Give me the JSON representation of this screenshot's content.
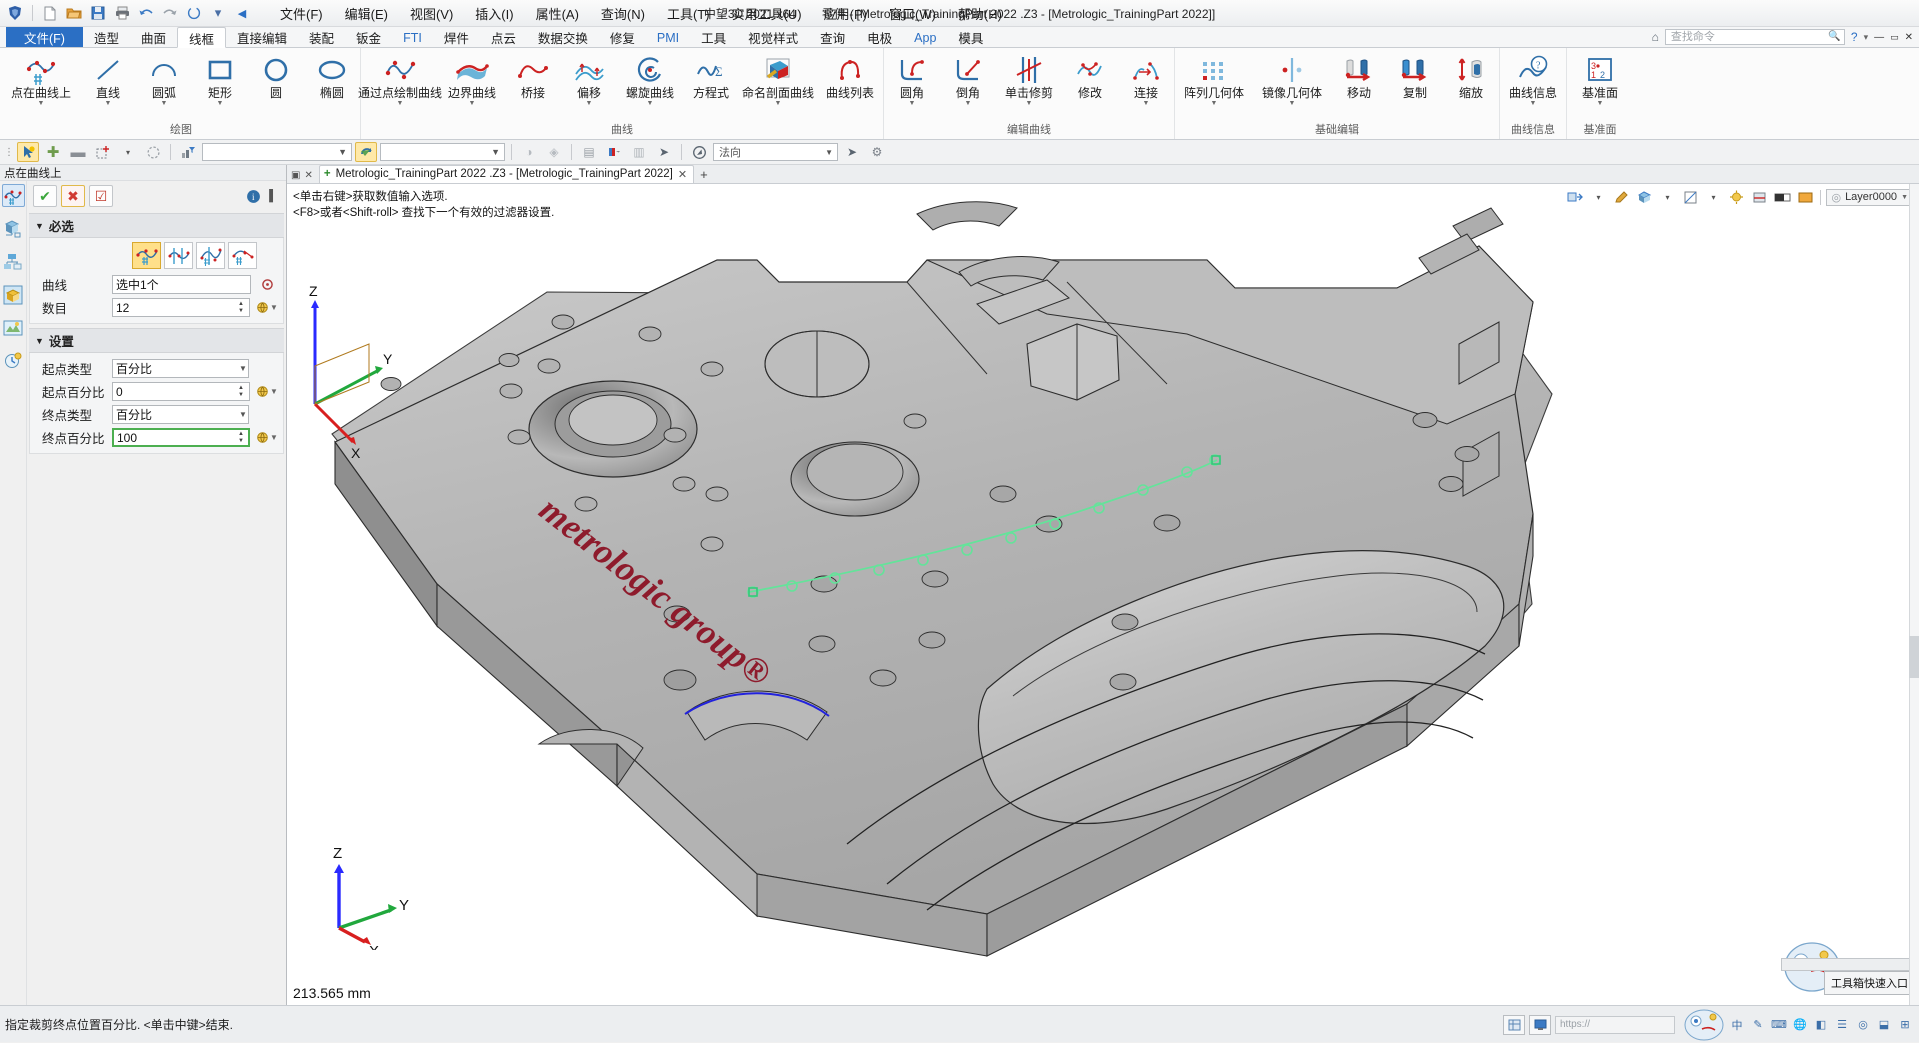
{
  "titlebar": {
    "quick_access": [
      "new-icon",
      "open-icon",
      "save-icon",
      "print-icon",
      "undo-icon",
      "redo-icon",
      "refresh-icon",
      "dropdown-icon",
      "back-icon"
    ],
    "menus": [
      "文件(F)",
      "编辑(E)",
      "视图(V)",
      "插入(I)",
      "属性(A)",
      "查询(N)",
      "工具(T)",
      "实用工具(U)",
      "应用(P)",
      "窗口(W)",
      "帮助(H)"
    ],
    "app_name": "中望3D 2021 x64",
    "document_title": "零件 - [Metrologic_TrainingPart  2022 .Z3 - [Metrologic_TrainingPart  2022]]",
    "window_buttons": [
      "−",
      "▭",
      "✕"
    ]
  },
  "ribbon": {
    "tabs": [
      {
        "label": "文件(F)",
        "style": "file"
      },
      {
        "label": "造型",
        "style": ""
      },
      {
        "label": "曲面",
        "style": ""
      },
      {
        "label": "线框",
        "style": "active"
      },
      {
        "label": "直接编辑",
        "style": ""
      },
      {
        "label": "装配",
        "style": ""
      },
      {
        "label": "钣金",
        "style": ""
      },
      {
        "label": "FTI",
        "style": "blue"
      },
      {
        "label": "焊件",
        "style": ""
      },
      {
        "label": "点云",
        "style": ""
      },
      {
        "label": "数据交换",
        "style": ""
      },
      {
        "label": "修复",
        "style": ""
      },
      {
        "label": "PMI",
        "style": "blue"
      },
      {
        "label": "工具",
        "style": ""
      },
      {
        "label": "视觉样式",
        "style": ""
      },
      {
        "label": "查询",
        "style": ""
      },
      {
        "label": "电极",
        "style": ""
      },
      {
        "label": "App",
        "style": "blue"
      },
      {
        "label": "模具",
        "style": ""
      }
    ],
    "search_placeholder": "查找命令",
    "home_icon": "home-icon",
    "help_icon": "help-icon",
    "groups": [
      {
        "name": "绘图",
        "items": [
          {
            "label": "点在曲线上",
            "icon": "point-on-curve-icon",
            "dropdown": true,
            "width": "xwide"
          },
          {
            "label": "直线",
            "icon": "line-icon",
            "dropdown": true,
            "width": ""
          },
          {
            "label": "圆弧",
            "icon": "arc-icon",
            "dropdown": true,
            "width": ""
          },
          {
            "label": "矩形",
            "icon": "rectangle-icon",
            "dropdown": true,
            "width": ""
          },
          {
            "label": "圆",
            "icon": "circle-icon",
            "dropdown": false,
            "width": ""
          },
          {
            "label": "椭圆",
            "icon": "ellipse-icon",
            "dropdown": false,
            "width": ""
          }
        ]
      },
      {
        "name": "曲线",
        "items": [
          {
            "label": "通过点绘制曲线",
            "icon": "curve-through-points-icon",
            "dropdown": true,
            "width": "xwide"
          },
          {
            "label": "边界曲线",
            "icon": "boundary-curve-icon",
            "dropdown": true,
            "width": "wide"
          },
          {
            "label": "桥接",
            "icon": "bridge-icon",
            "dropdown": false,
            "width": ""
          },
          {
            "label": "偏移",
            "icon": "offset-icon",
            "dropdown": true,
            "width": ""
          },
          {
            "label": "螺旋曲线",
            "icon": "helix-icon",
            "dropdown": true,
            "width": "wide"
          },
          {
            "label": "方程式",
            "icon": "equation-icon",
            "dropdown": false,
            "width": ""
          },
          {
            "label": "命名剖面曲线",
            "icon": "named-section-curve-icon",
            "dropdown": true,
            "width": "xwide"
          },
          {
            "label": "曲线列表",
            "icon": "curve-list-icon",
            "dropdown": false,
            "width": "wide"
          }
        ]
      },
      {
        "name": "编辑曲线",
        "items": [
          {
            "label": "圆角",
            "icon": "fillet-icon",
            "dropdown": true,
            "width": ""
          },
          {
            "label": "倒角",
            "icon": "chamfer-icon",
            "dropdown": true,
            "width": ""
          },
          {
            "label": "单击修剪",
            "icon": "click-trim-icon",
            "dropdown": true,
            "width": "wide"
          },
          {
            "label": "修改",
            "icon": "modify-icon",
            "dropdown": false,
            "width": ""
          },
          {
            "label": "连接",
            "icon": "connect-icon",
            "dropdown": true,
            "width": ""
          }
        ]
      },
      {
        "name": "基础编辑",
        "items": [
          {
            "label": "阵列几何体",
            "icon": "pattern-geometry-icon",
            "dropdown": true,
            "width": "xwide"
          },
          {
            "label": "镜像几何体",
            "icon": "mirror-geometry-icon",
            "dropdown": true,
            "width": "xwide"
          },
          {
            "label": "移动",
            "icon": "move-icon",
            "dropdown": false,
            "width": ""
          },
          {
            "label": "复制",
            "icon": "copy-icon",
            "dropdown": false,
            "width": ""
          },
          {
            "label": "缩放",
            "icon": "scale-icon",
            "dropdown": false,
            "width": ""
          }
        ]
      },
      {
        "name": "曲线信息",
        "items": [
          {
            "label": "曲线信息",
            "icon": "curve-info-icon",
            "dropdown": true,
            "width": "wide"
          }
        ]
      },
      {
        "name": "基准面",
        "items": [
          {
            "label": "基准面",
            "icon": "datum-plane-icon",
            "dropdown": true,
            "width": "wide"
          }
        ]
      }
    ]
  },
  "attrbar": {
    "icons": [
      "pointer-select-icon",
      "add-icon",
      "remove-icon",
      "add-point-icon",
      "dropdown-icon",
      "circle-select-icon",
      "filter-icon"
    ],
    "combo_value": "",
    "sync_icon": "sync-icon",
    "right_icons": [
      "render-icon",
      "shade-icon",
      "face-icon",
      "face-color-icon",
      "layer-icon",
      "pointer-icon"
    ],
    "normal_label": "法向",
    "tail_icons": [
      "arrow-icon",
      "settings-gear-icon"
    ]
  },
  "left_panel": {
    "title": "点在曲线上",
    "rail_icons": [
      "point-on-curve-icon",
      "assembly-icon",
      "hierarchy-icon",
      "part-icon",
      "render-preview-icon",
      "history-icon"
    ],
    "form_buttons": {
      "ok": "✔",
      "cancel": "✖",
      "apply": "☑"
    },
    "info_icons": [
      "info-icon",
      "pin-icon"
    ],
    "sections": [
      {
        "header": "必选",
        "method_buttons": [
          "uniform-points-icon",
          "endpoint-points-icon",
          "spacing-points-icon",
          "arc-points-icon"
        ],
        "selected_method": 0,
        "fields": [
          {
            "label": "曲线",
            "value": "选中1个",
            "type": "pick",
            "trailing": "target-icon"
          },
          {
            "label": "数目",
            "value": "12",
            "type": "spinner",
            "trailing": "global-icon"
          }
        ]
      },
      {
        "header": "设置",
        "fields": [
          {
            "label": "起点类型",
            "value": "百分比",
            "type": "dropdown",
            "trailing": ""
          },
          {
            "label": "起点百分比",
            "value": "0",
            "type": "spinner",
            "trailing": "global-icon"
          },
          {
            "label": "终点类型",
            "value": "百分比",
            "type": "dropdown",
            "trailing": ""
          },
          {
            "label": "终点百分比",
            "value": "100",
            "type": "spinner",
            "trailing": "global-icon",
            "highlight": true
          }
        ]
      }
    ]
  },
  "viewport": {
    "tab_label": "Metrologic_TrainingPart  2022 .Z3 - [Metrologic_TrainingPart  2022]",
    "tab_plus": "+",
    "tab_close": "✕",
    "new_tab": "+",
    "prompts": [
      "<单击右键>获取数值输入选项.",
      "<F8>或者<Shift-roll> 查找下一个有效的过滤器设置."
    ],
    "toolbar_icons": [
      "view-orient-icon",
      "visual-style-icon",
      "pencil-icon",
      "shape-icon",
      "datum-icon",
      "light-icon",
      "section-icon",
      "background-icon"
    ],
    "layer_label": "Layer0000",
    "dimension_readout": "213.565 mm",
    "triad_labels": {
      "x": "X",
      "y": "Y",
      "z": "Z"
    },
    "origin_triad_labels": {
      "x": "X",
      "y": "Y",
      "z": "Z"
    },
    "tool_palette_label": "工具箱快速入口",
    "part_logo_text": "metrologic group®"
  },
  "statusbar": {
    "message": "指定裁剪终点位置百分比. <单击中键>结束.",
    "right_icons": [
      "grid-icon",
      "monitor-icon"
    ],
    "url_placeholder": "https://",
    "tray_items": [
      "中",
      "✎",
      "⌨",
      "🌐",
      "◧",
      "☰",
      "◎",
      "⬓",
      "⊞"
    ],
    "tray_time": ""
  },
  "colors": {
    "accent_blue": "#2b6fc4",
    "tab_active_bg": "#ffffff",
    "ribbon_bg": "#fbfbfb",
    "panel_bg": "#f0f0f0",
    "selected_yellow": "#ffe08a",
    "viewport_bg": "#ffffff",
    "part_gray": "#b6b6b6",
    "logo_red": "#9b1b2e",
    "curve_green": "#7de8a0",
    "edge_blue": "#2222dd"
  }
}
